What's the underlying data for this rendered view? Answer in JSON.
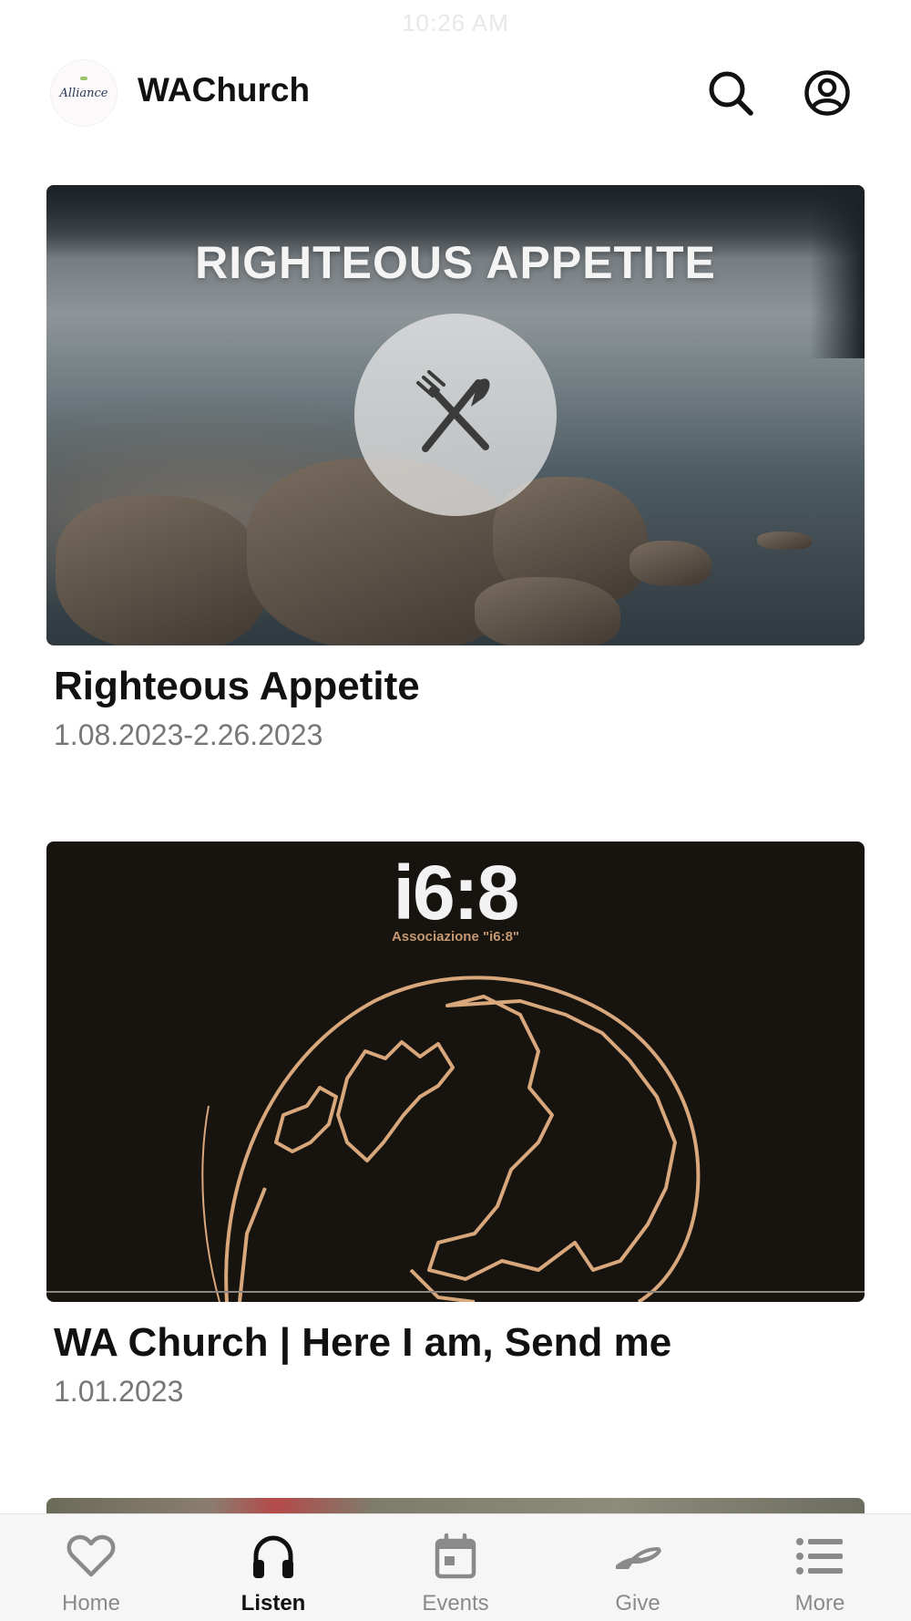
{
  "status_bar": {
    "time": "10:26 AM"
  },
  "header": {
    "logo_text": "Alliance",
    "title": "WAChurch",
    "search_icon": "search-icon",
    "profile_icon": "user-circle-icon"
  },
  "cards": [
    {
      "banner_text": "RIGHTEOUS APPETITE",
      "title": "Righteous Appetite",
      "subtitle": "1.08.2023-2.26.2023",
      "icon": "fork-knife-icon"
    },
    {
      "logo_text": "i6:8",
      "logo_sub": "Associazione \"i6:8\"",
      "title": "WA Church | Here I am, Send me",
      "subtitle": "1.01.2023",
      "icon": "globe-icon"
    }
  ],
  "tabbar": {
    "tabs": [
      {
        "label": "Home",
        "icon": "heart-icon",
        "active": false
      },
      {
        "label": "Listen",
        "icon": "headphones-icon",
        "active": true
      },
      {
        "label": "Events",
        "icon": "calendar-icon",
        "active": false
      },
      {
        "label": "Give",
        "icon": "give-hand-icon",
        "active": false
      },
      {
        "label": "More",
        "icon": "list-icon",
        "active": false
      }
    ]
  },
  "colors": {
    "active_tab": "#111111",
    "inactive_tab": "#8a8a8a",
    "subtitle": "#777777",
    "globe_outline": "#d8a77c"
  }
}
